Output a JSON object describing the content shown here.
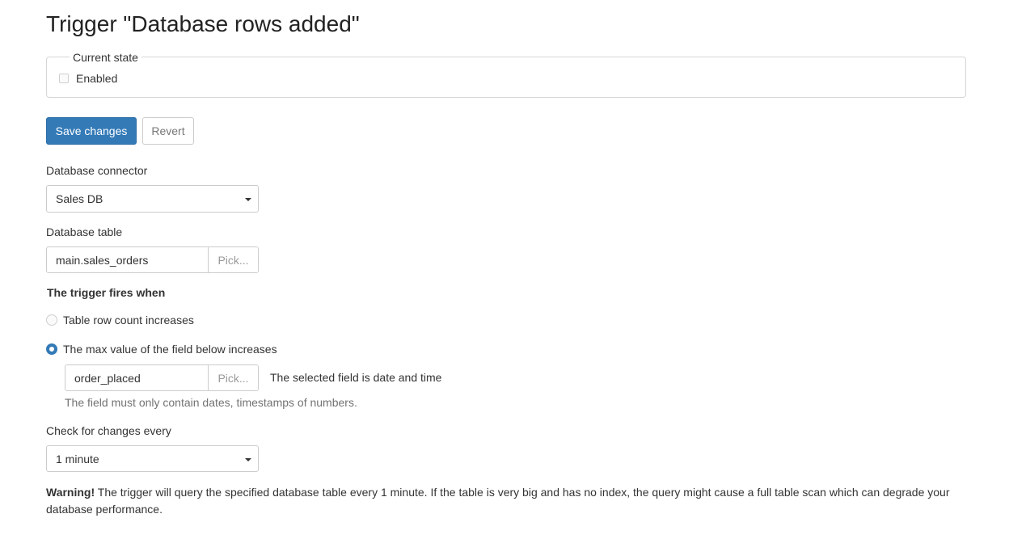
{
  "page": {
    "title": "Trigger \"Database rows added\""
  },
  "current_state": {
    "legend": "Current state",
    "enabled_label": "Enabled",
    "enabled_checked": false
  },
  "actions": {
    "save_label": "Save changes",
    "revert_label": "Revert"
  },
  "connector": {
    "label": "Database connector",
    "selected": "Sales DB"
  },
  "table": {
    "label": "Database table",
    "value": "main.sales_orders",
    "pick_label": "Pick..."
  },
  "fires_when": {
    "heading": "The trigger fires when",
    "option_row_count": "Table row count increases",
    "option_max_value": "The max value of the field below increases",
    "selected_option": "max_value",
    "field_value": "order_placed",
    "field_pick_label": "Pick...",
    "field_note": "The selected field is date and time",
    "help_text": "The field must only contain dates, timestamps of numbers."
  },
  "interval": {
    "label": "Check for changes every",
    "selected": "1 minute"
  },
  "warning": {
    "prefix": "Warning!",
    "text": " The trigger will query the specified database table every 1 minute. If the table is very big and has no index, the query might cause a full table scan which can degrade your database performance."
  },
  "colors": {
    "primary": "#337ab7",
    "border": "#cccccc",
    "muted": "#737373"
  }
}
